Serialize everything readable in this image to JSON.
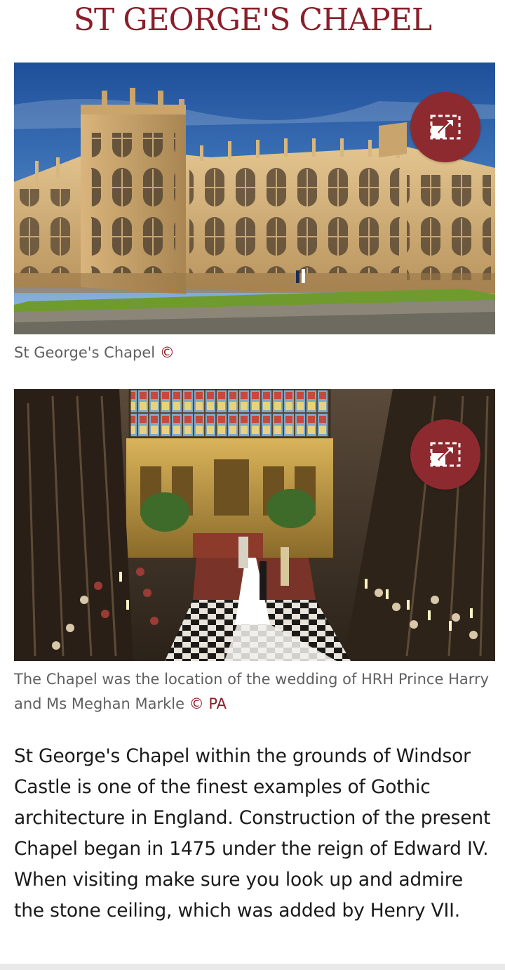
{
  "page": {
    "title": "ST GEORGE'S CHAPEL"
  },
  "figures": [
    {
      "caption": "St George's Chapel",
      "credit": "©",
      "expand_icon": "expand-icon"
    },
    {
      "caption": "The Chapel was the location of the wedding of HRH Prince Harry and Ms Meghan Markle",
      "credit": "© PA",
      "expand_icon": "expand-icon"
    }
  ],
  "article": {
    "paragraph": "St George's Chapel within the grounds of Windsor Castle is one of the finest examples of Gothic architecture in England. Construction of the present Chapel began in 1475 under the reign of Edward IV. When visiting make sure you look up and admire the stone ceiling, which was added by Henry VII."
  },
  "colors": {
    "brand": "#8a1f2b",
    "button": "#8d2a2f",
    "caption_text": "#5f5f5f",
    "body_text": "#1a1a1a"
  }
}
